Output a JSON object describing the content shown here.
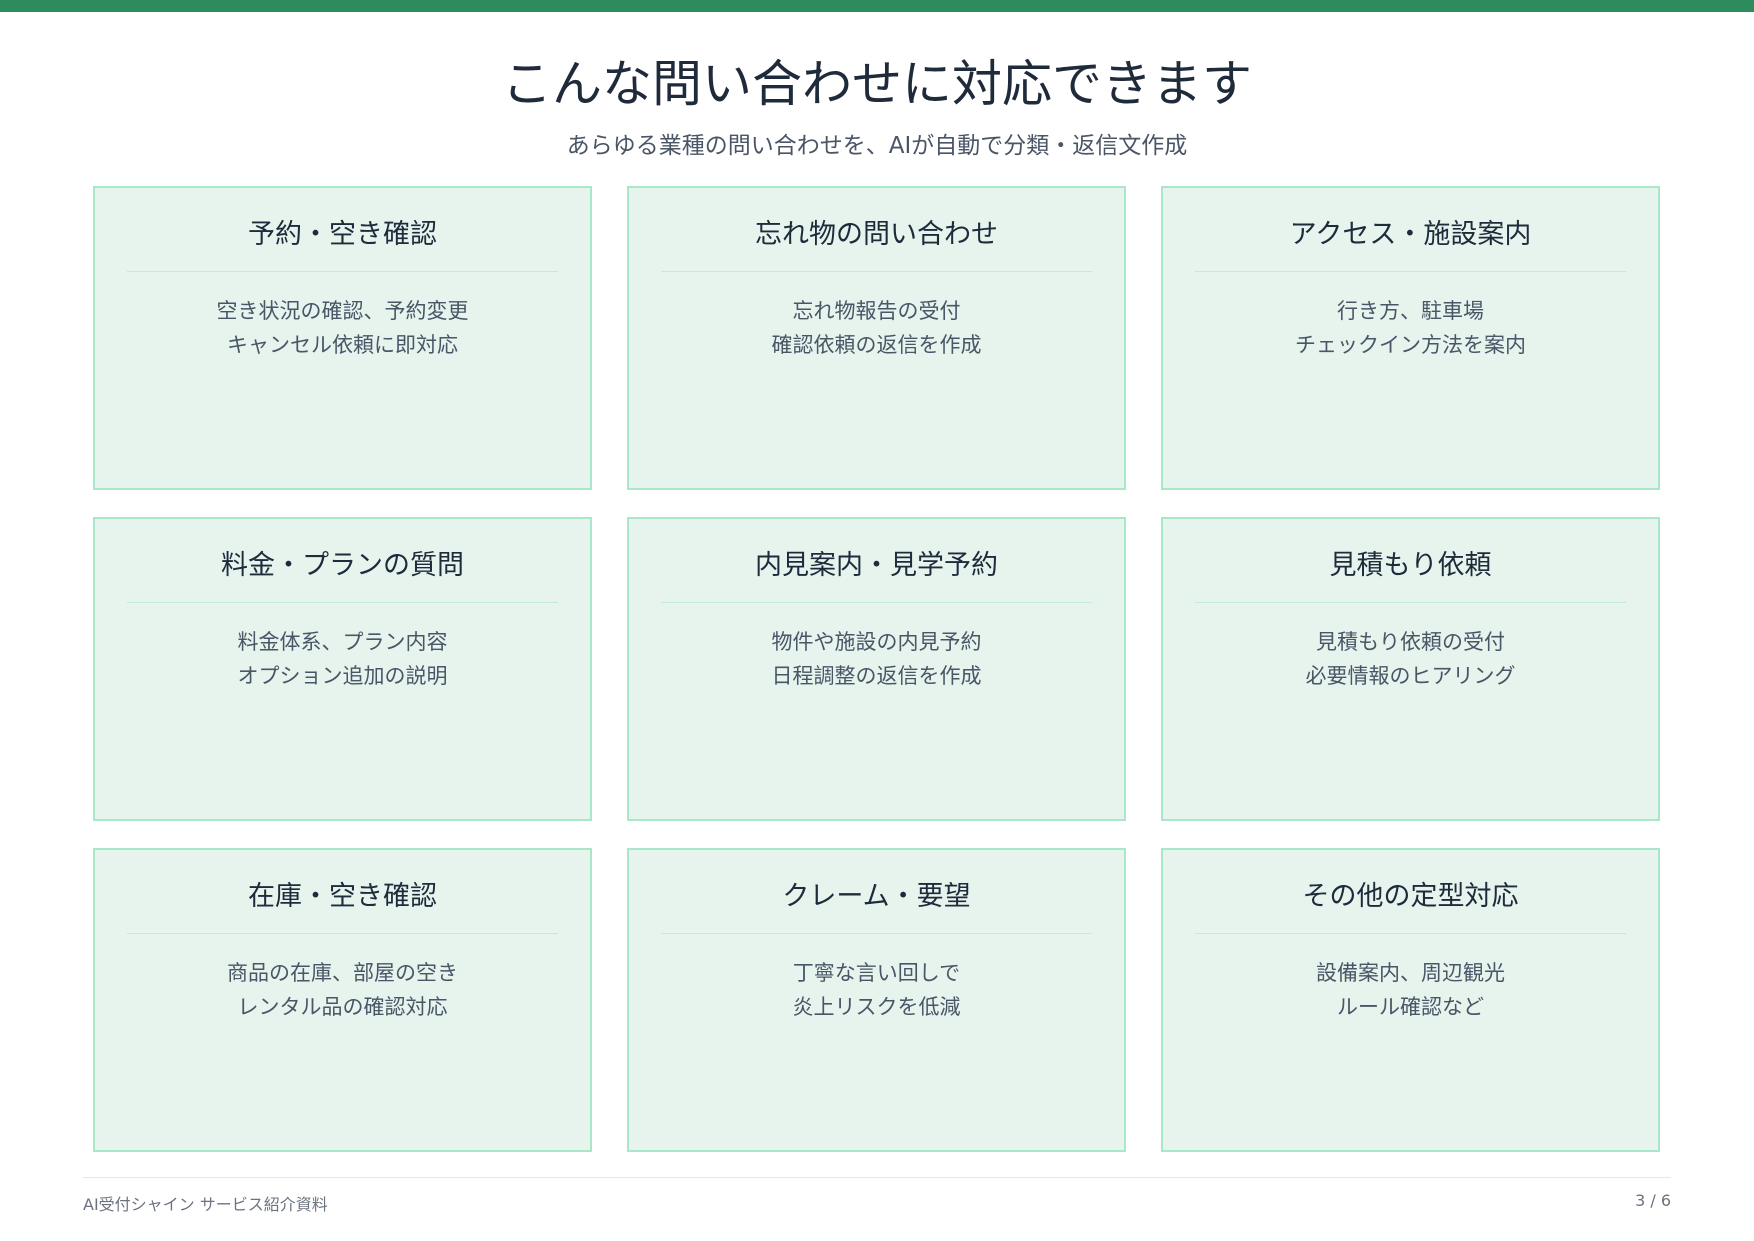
{
  "header": {
    "title": "こんな問い合わせに対応できます",
    "subtitle": "あらゆる業種の問い合わせを、AIが自動で分類・返信文作成"
  },
  "cards": [
    {
      "title": "予約・空き確認",
      "lines": [
        "空き状況の確認、予約変更",
        "キャンセル依頼に即対応"
      ]
    },
    {
      "title": "忘れ物の問い合わせ",
      "lines": [
        "忘れ物報告の受付",
        "確認依頼の返信を作成"
      ]
    },
    {
      "title": "アクセス・施設案内",
      "lines": [
        "行き方、駐車場",
        "チェックイン方法を案内"
      ]
    },
    {
      "title": "料金・プランの質問",
      "lines": [
        "料金体系、プラン内容",
        "オプション追加の説明"
      ]
    },
    {
      "title": "内見案内・見学予約",
      "lines": [
        "物件や施設の内見予約",
        "日程調整の返信を作成"
      ]
    },
    {
      "title": "見積もり依頼",
      "lines": [
        "見積もり依頼の受付",
        "必要情報のヒアリング"
      ]
    },
    {
      "title": "在庫・空き確認",
      "lines": [
        "商品の在庫、部屋の空き",
        "レンタル品の確認対応"
      ]
    },
    {
      "title": "クレーム・要望",
      "lines": [
        "丁寧な言い回しで",
        "炎上リスクを低減"
      ]
    },
    {
      "title": "その他の定型対応",
      "lines": [
        "設備案内、周辺観光",
        "ルール確認など"
      ]
    }
  ],
  "footer": {
    "doc_name": "AI受付シャイン サービス紹介資料",
    "page": "3 / 6"
  },
  "colors": {
    "accent": "#2e8b5e",
    "card_bg": "#e7f4ee",
    "card_border": "#a6e8c8"
  }
}
